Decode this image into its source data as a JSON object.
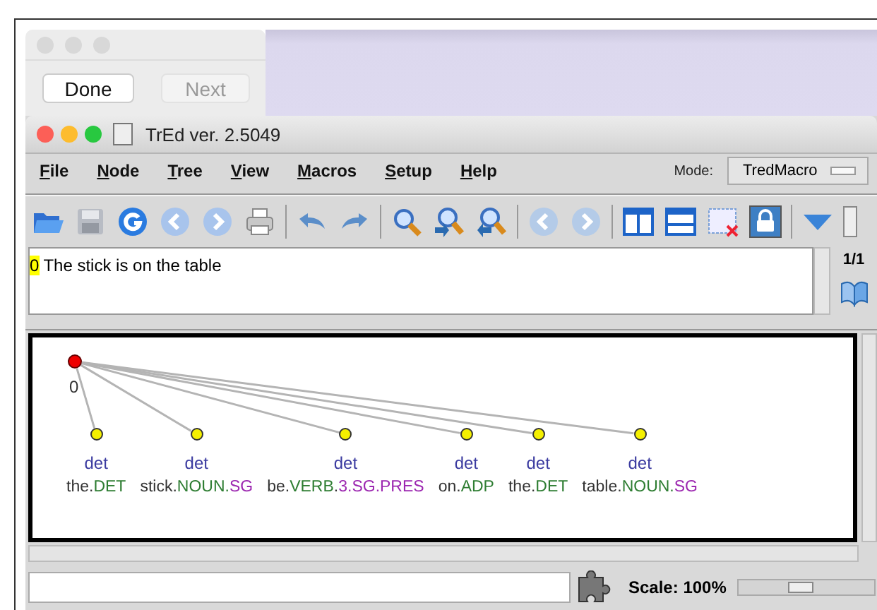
{
  "dialog": {
    "buttons": [
      {
        "label": "Done",
        "disabled": false
      },
      {
        "label": "Next",
        "disabled": true
      }
    ]
  },
  "window": {
    "title": "TrEd ver. 2.5049"
  },
  "menu": [
    {
      "label": "File"
    },
    {
      "label": "Node"
    },
    {
      "label": "Tree"
    },
    {
      "label": "View"
    },
    {
      "label": "Macros"
    },
    {
      "label": "Setup"
    },
    {
      "label": "Help"
    }
  ],
  "mode": {
    "label": "Mode:",
    "value": "TredMacro"
  },
  "sentence": {
    "index": "0",
    "text": "The stick is on the table"
  },
  "counter": "1/1",
  "tree": {
    "label": "0",
    "selected": true,
    "children": [
      {
        "selected": false,
        "afun": "det",
        "word": [
          {
            "text": "the.",
            "color": "#333333"
          },
          {
            "text": "DET",
            "color": "#2e7d32"
          }
        ]
      },
      {
        "selected": false,
        "afun": "det",
        "word": [
          {
            "text": "stick.",
            "color": "#333333"
          },
          {
            "text": "NOUN.",
            "color": "#2e7d32"
          },
          {
            "text": "SG",
            "color": "#9c27b0"
          }
        ]
      },
      {
        "selected": false,
        "afun": "det",
        "word": [
          {
            "text": "be.",
            "color": "#333333"
          },
          {
            "text": "VERB",
            "color": "#2e7d32"
          },
          {
            "text": ".",
            "color": "#333333"
          },
          {
            "text": "3.SG.PRES",
            "color": "#9c27b0"
          }
        ]
      },
      {
        "selected": false,
        "afun": "det",
        "word": [
          {
            "text": "on.",
            "color": "#333333"
          },
          {
            "text": "ADP",
            "color": "#2e7d32"
          }
        ]
      },
      {
        "selected": false,
        "afun": "det",
        "word": [
          {
            "text": "the.",
            "color": "#333333"
          },
          {
            "text": "DET",
            "color": "#2e7d32"
          }
        ]
      },
      {
        "selected": false,
        "afun": "det",
        "word": [
          {
            "text": "table.",
            "color": "#333333"
          },
          {
            "text": "NOUN.",
            "color": "#2e7d32"
          },
          {
            "text": "SG",
            "color": "#9c27b0"
          }
        ]
      }
    ]
  },
  "status": {
    "scale": "Scale: 100%",
    "slider": {
      "level": 0.45
    }
  }
}
